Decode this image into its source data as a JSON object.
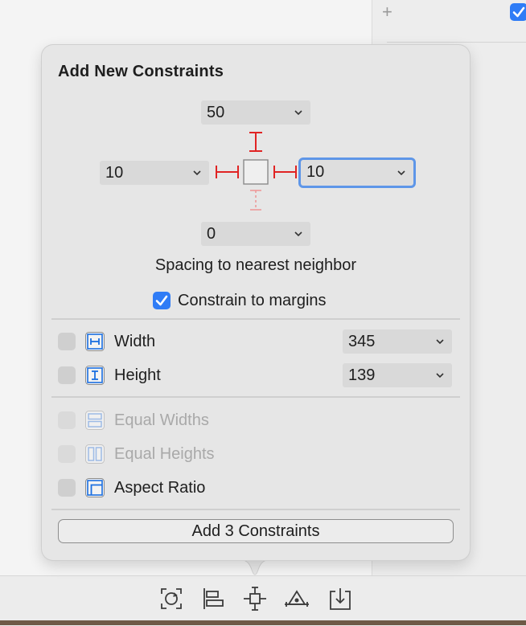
{
  "panel": {
    "title": "Add New Constraints",
    "spacing_top": "50",
    "spacing_left": "10",
    "spacing_right": "10",
    "spacing_bottom": "0",
    "spacing_caption": "Spacing to nearest neighbor",
    "constrain_margins_label": "Constrain to margins",
    "constrain_margins_checked": true
  },
  "size": {
    "width_label": "Width",
    "width_value": "345",
    "height_label": "Height",
    "height_value": "139"
  },
  "options": {
    "equal_widths_label": "Equal Widths",
    "equal_heights_label": "Equal Heights",
    "aspect_ratio_label": "Aspect Ratio"
  },
  "actions": {
    "add_button_label": "Add 3 Constraints"
  },
  "colors": {
    "accent": "#2f7cf6",
    "constraint_red": "#e02424",
    "icon_blue": "#1b6fe0"
  }
}
